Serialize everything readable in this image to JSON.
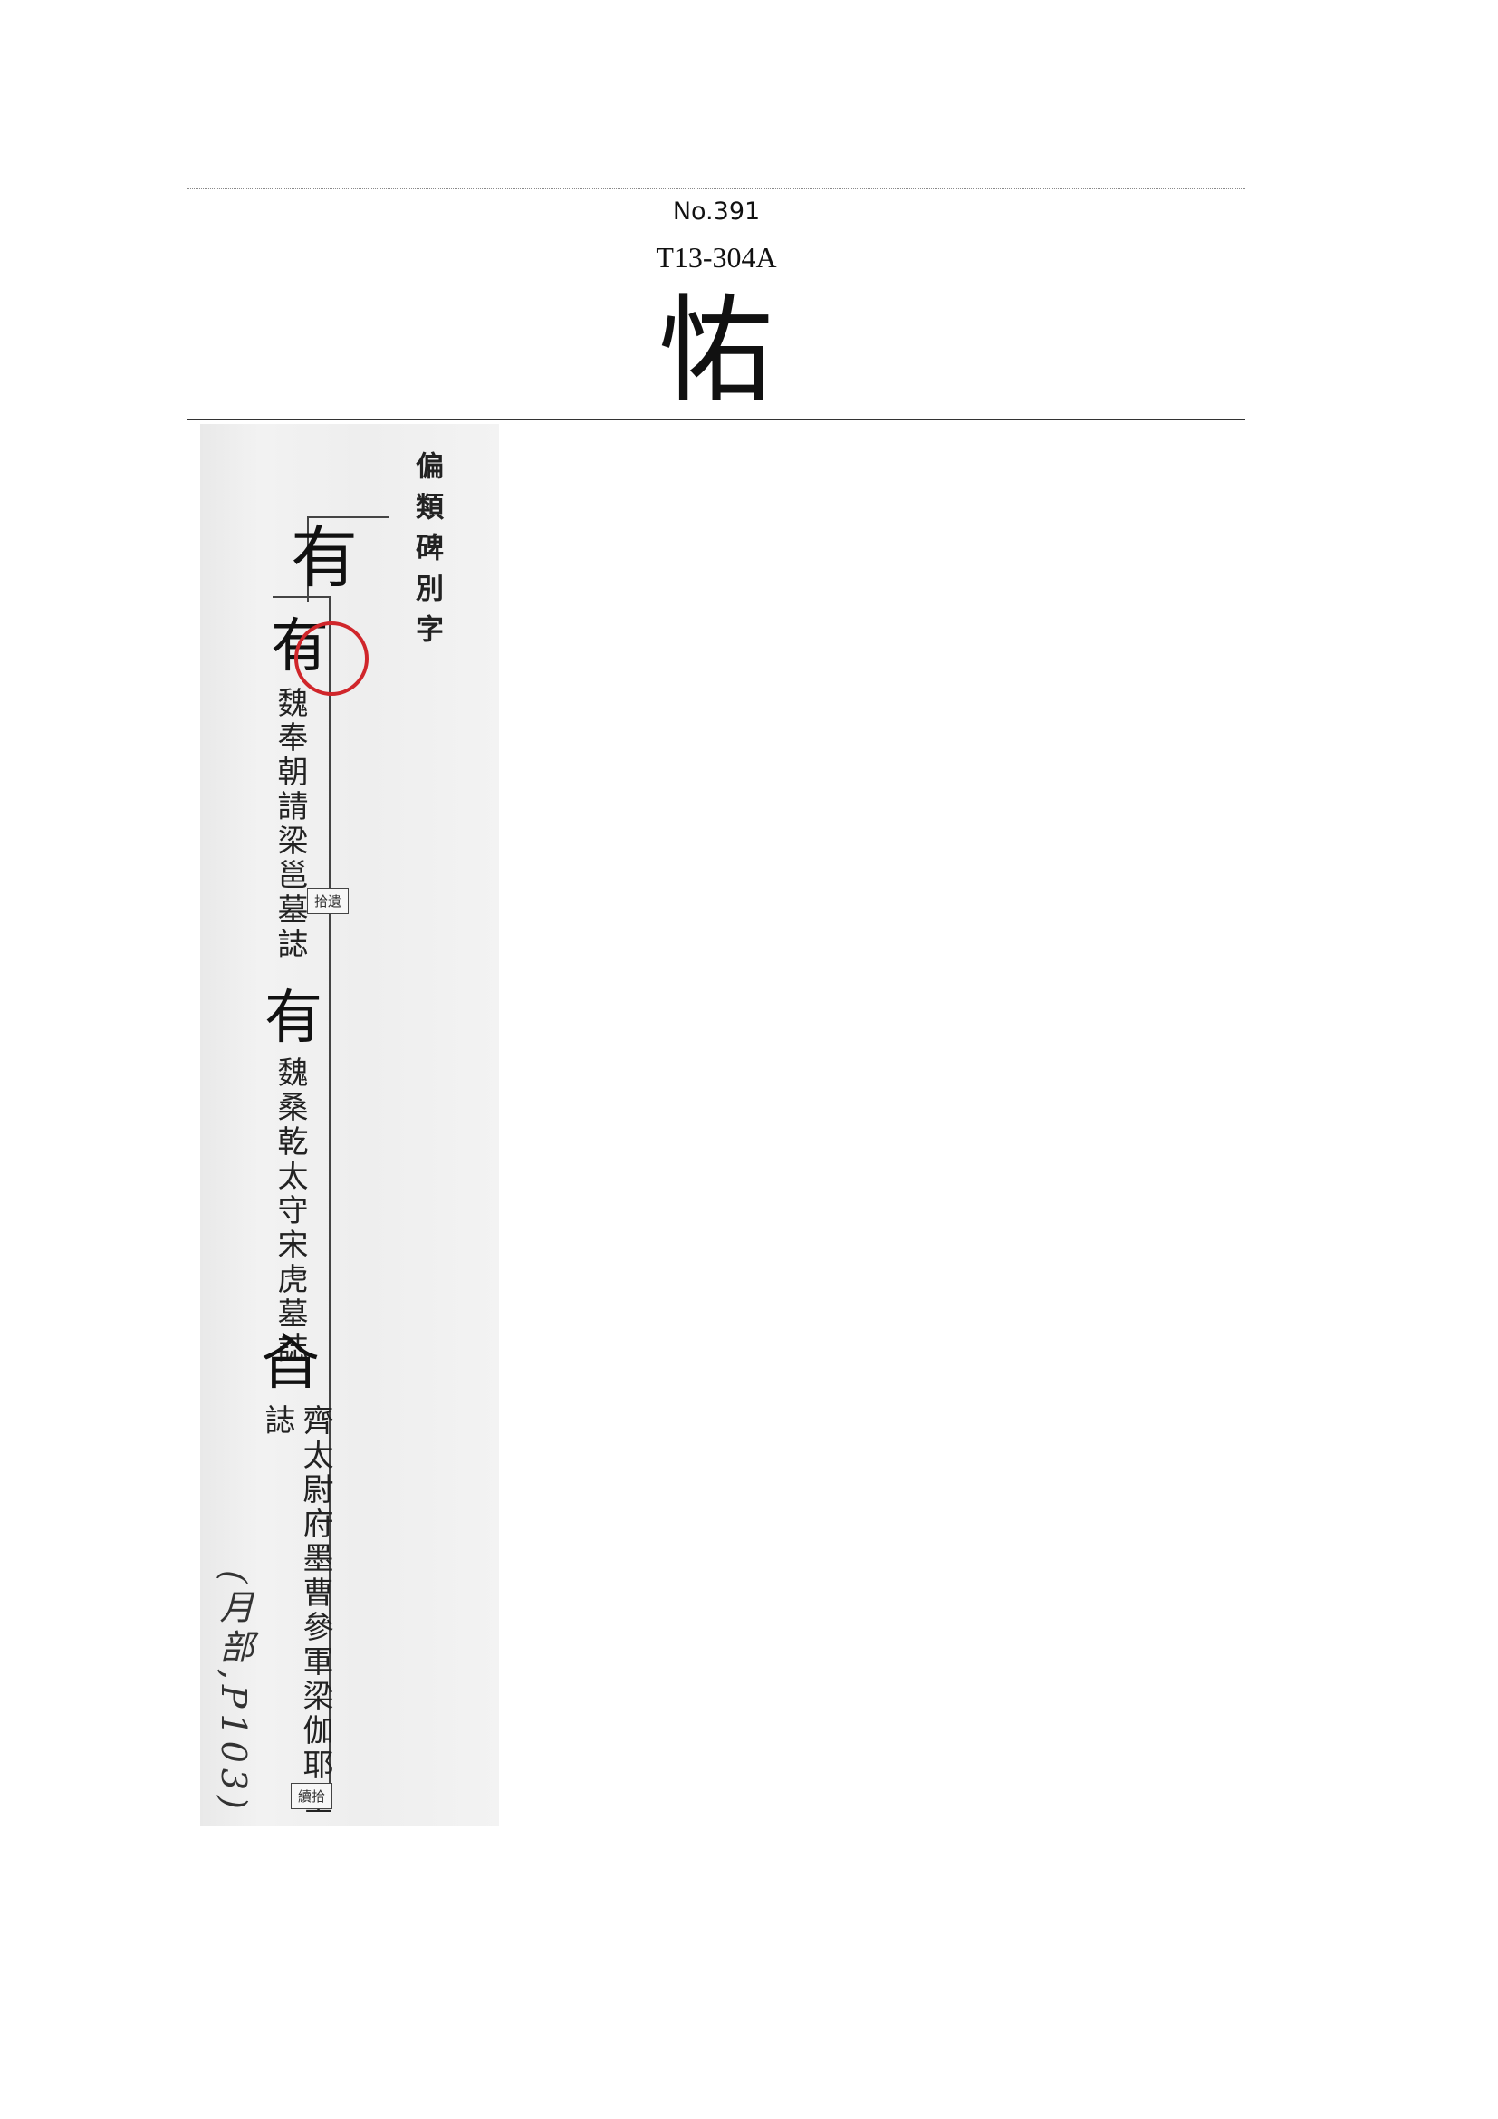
{
  "header": {
    "number": "No.391",
    "code": "T13-304A",
    "character": "㤑"
  },
  "scan": {
    "book_title": "偏類碑別字",
    "radical": "有",
    "entries": [
      {
        "character": "有",
        "source": "魏奉朝請梁邕墓誌",
        "tag": "拾遺"
      },
      {
        "character": "有",
        "source": "魏桑乾太守宋虎墓誌"
      },
      {
        "character": "㒲",
        "source": "齊太尉府墨曹參軍梁伽耶墓誌",
        "tag": "續拾"
      }
    ],
    "handwritten_note": "(月部,P103)"
  }
}
